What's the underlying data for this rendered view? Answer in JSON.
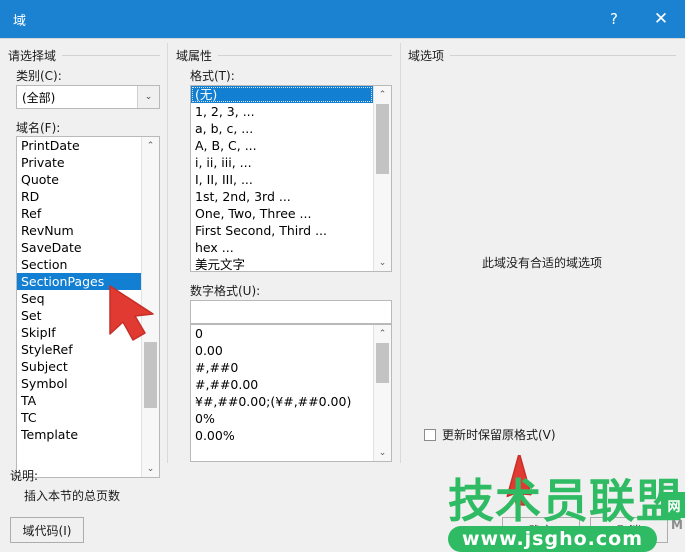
{
  "window": {
    "title": "域",
    "help_button": "?",
    "close_button": "✕"
  },
  "groups": {
    "select_field": "请选择域",
    "field_properties": "域属性",
    "field_options": "域选项"
  },
  "category": {
    "label": "类别(C):",
    "value": "(全部)",
    "arrow": "⌄"
  },
  "field_names": {
    "label": "域名(F):",
    "items": [
      "PrintDate",
      "Private",
      "Quote",
      "RD",
      "Ref",
      "RevNum",
      "SaveDate",
      "Section",
      "SectionPages",
      "Seq",
      "Set",
      "SkipIf",
      "StyleRef",
      "Subject",
      "Symbol",
      "TA",
      "TC",
      "Template"
    ],
    "selected": "SectionPages",
    "scroll_up": "⌃",
    "scroll_down": "⌄"
  },
  "format": {
    "label": "格式(T):",
    "items": [
      "(无)",
      "1, 2, 3, ...",
      "a, b, c, ...",
      "A, B, C, ...",
      "i, ii, iii, ...",
      "I, II, III, ...",
      "1st, 2nd, 3rd ...",
      "One, Two, Three ...",
      "First Second, Third ...",
      "hex ...",
      "美元文字"
    ],
    "selected": "(无)",
    "scroll_up": "⌃",
    "scroll_down": "⌄"
  },
  "number_format": {
    "label": "数字格式(U):",
    "value": "",
    "items": [
      "0",
      "0.00",
      "#,##0",
      "#,##0.00",
      "¥#,##0.00;(¥#,##0.00)",
      "0%",
      "0.00%"
    ],
    "scroll_up": "⌃",
    "scroll_down": "⌄"
  },
  "field_options": {
    "empty_message": "此域没有合适的域选项",
    "preserve_format_label": "更新时保留原格式(V)",
    "preserve_format_checked": false
  },
  "description": {
    "label": "说明:",
    "text": "插入本节的总页数"
  },
  "buttons": {
    "field_codes": "域代码(I)",
    "ok": "确定",
    "cancel": "取消"
  },
  "watermark": {
    "brand": "技术员联盟",
    "url": "www.jsgho.com",
    "badge": "网",
    "suffix": "M"
  },
  "colors": {
    "titlebar": "#1b82d2",
    "selection": "#127fd2",
    "dialog_bg": "#f0f0f0",
    "watermark_green": "#2fbb63",
    "cursor_red": "#e03a32"
  }
}
